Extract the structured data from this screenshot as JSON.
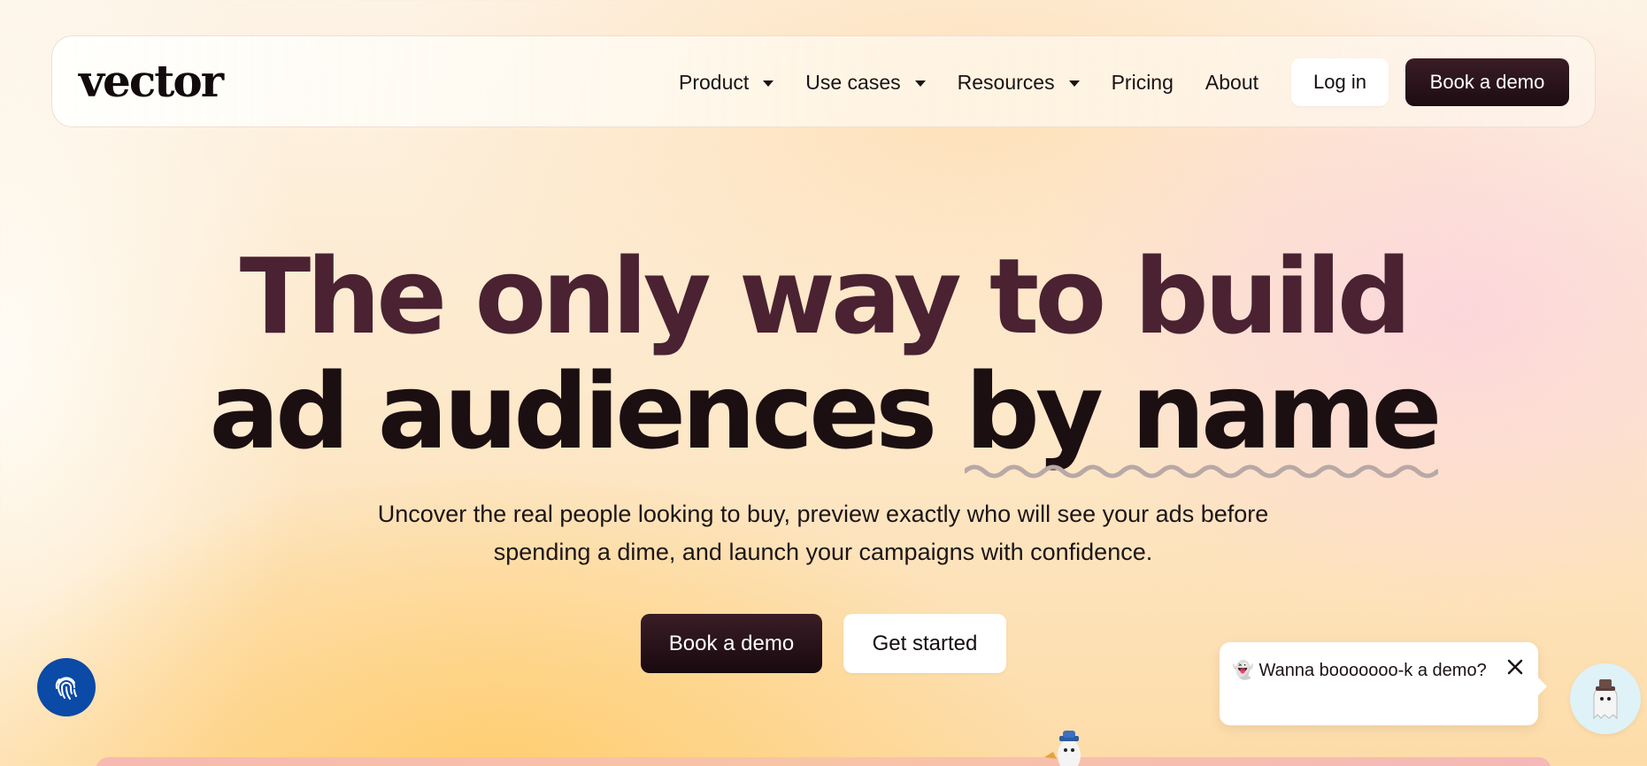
{
  "nav": {
    "logo": "vector",
    "links": [
      {
        "label": "Product",
        "has_dropdown": true,
        "icon": "caret-down-icon"
      },
      {
        "label": "Use cases",
        "has_dropdown": true,
        "icon": "caret-down-icon"
      },
      {
        "label": "Resources",
        "has_dropdown": true,
        "icon": "caret-down-icon"
      },
      {
        "label": "Pricing",
        "has_dropdown": false
      },
      {
        "label": "About",
        "has_dropdown": false
      }
    ],
    "login_label": "Log in",
    "demo_label": "Book a demo"
  },
  "hero": {
    "title_line1": "The only way to build",
    "title_line2_prefix": "ad audiences ",
    "title_line2_highlight": "by name",
    "subtitle_line1": "Uncover the real people looking to buy, preview exactly who will see your ads before",
    "subtitle_line2": "spending a dime, and launch your campaigns with confidence.",
    "primary_cta": "Book a demo",
    "secondary_cta": "Get started"
  },
  "chat": {
    "emoji": "👻",
    "message": "Wanna booooooo-k a demo?",
    "close_icon": "close-icon",
    "avatar_icon": "ghost-mascot-icon"
  },
  "floating": {
    "fingerprint_icon": "fingerprint-icon"
  },
  "colors": {
    "brand_dark": "#1c0c11",
    "title_plum": "#4a2232",
    "fab_blue": "#0b4aa6",
    "squiggle": "#b8a8a6"
  }
}
